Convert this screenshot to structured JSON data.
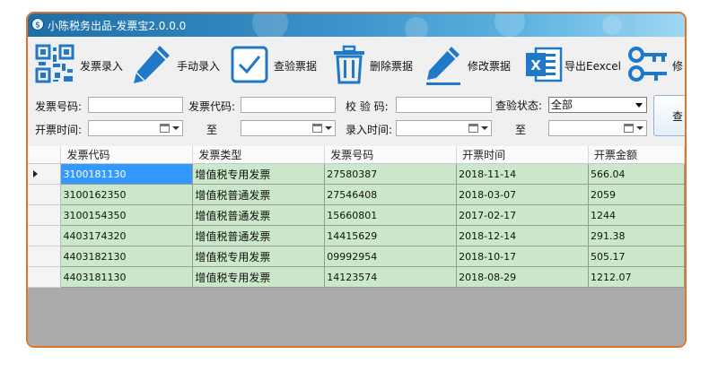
{
  "window": {
    "title": "小陈税务出品-发票宝2.0.0.0"
  },
  "toolbar": {
    "items": [
      {
        "label": "发票录入",
        "icon": "qr-code-icon"
      },
      {
        "label": "手动录入",
        "icon": "pen-icon"
      },
      {
        "label": "查验票据",
        "icon": "checkbox-icon"
      },
      {
        "label": "删除票据",
        "icon": "trash-icon"
      },
      {
        "label": "修改票据",
        "icon": "edit-pen-icon"
      },
      {
        "label": "导出Eexcel",
        "icon": "excel-icon"
      },
      {
        "label": "修",
        "icon": "key-icon"
      }
    ]
  },
  "filters": {
    "invoice_number_label": "发票号码:",
    "invoice_code_label": "发票代码:",
    "check_code_label": "校 验 码:",
    "status_label": "查验状态:",
    "status_value": "全部",
    "issue_time_label": "开票时间:",
    "to_label": "至",
    "entry_time_label": "录入时间:",
    "query_button": "查"
  },
  "table": {
    "columns": [
      "发票代码",
      "发票类型",
      "发票号码",
      "开票时间",
      "开票金额"
    ],
    "rows": [
      [
        "3100181130",
        "增值税专用发票",
        "27580387",
        "2018-11-14",
        "566.04"
      ],
      [
        "3100162350",
        "增值税普通发票",
        "27546408",
        "2018-03-07",
        "2059"
      ],
      [
        "3100154350",
        "增值税普通发票",
        "15660801",
        "2017-02-17",
        "1244"
      ],
      [
        "4403174320",
        "增值税普通发票",
        "14415629",
        "2018-12-14",
        "291.38"
      ],
      [
        "4403182130",
        "增值税专用发票",
        "09992954",
        "2018-10-17",
        "505.17"
      ],
      [
        "4403181130",
        "增值税专用发票",
        "14123574",
        "2018-08-29",
        "1212.07"
      ]
    ],
    "current_row": 0
  },
  "colors": {
    "frame_border": "#e0742c",
    "row_bg": "#cbe8cb",
    "selected_cell": "#3399ff",
    "icon_blue": "#1f78c8"
  }
}
